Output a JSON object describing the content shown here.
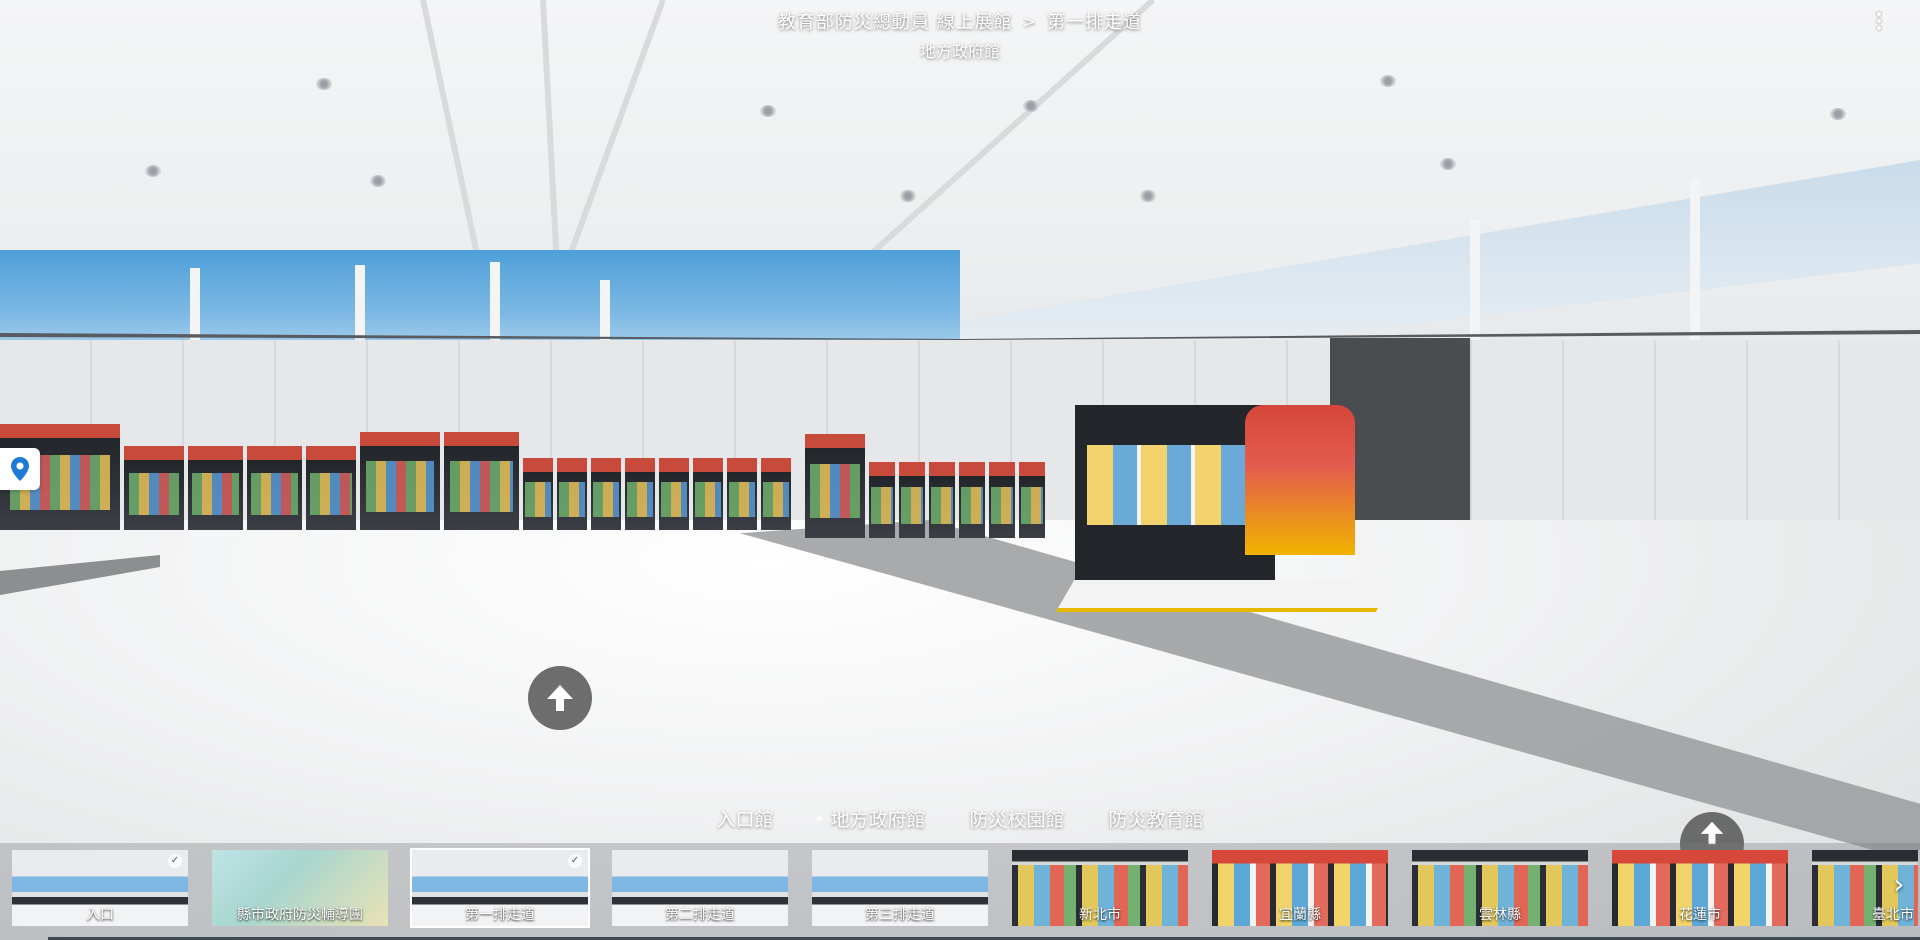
{
  "header": {
    "breadcrumb_root": "教育部防災總動員 線上展館",
    "breadcrumb_sep": ">",
    "breadcrumb_current": "第一排走道",
    "subtitle": "地方政府館"
  },
  "icons": {
    "menu": "more-vertical-icon",
    "map": "map-pin-icon",
    "hotspot": "arrow-up-icon",
    "next": "chevron-right-icon",
    "check": "check-icon"
  },
  "categories": [
    {
      "label": "入口館",
      "has_dot": false
    },
    {
      "label": "地方政府館",
      "has_dot": true
    },
    {
      "label": "防災校園館",
      "has_dot": false
    },
    {
      "label": "防災教育館",
      "has_dot": false
    }
  ],
  "thumbnails": [
    {
      "label": "入口",
      "checked": true,
      "active": false
    },
    {
      "label": "縣市政府防災輔導團",
      "checked": false,
      "active": false
    },
    {
      "label": "第一排走道",
      "checked": true,
      "active": true
    },
    {
      "label": "第二排走道",
      "checked": false,
      "active": false
    },
    {
      "label": "第三排走道",
      "checked": false,
      "active": false
    },
    {
      "label": "新北市",
      "checked": false,
      "active": false
    },
    {
      "label": "宜蘭縣",
      "checked": false,
      "active": false
    },
    {
      "label": "雲林縣",
      "checked": false,
      "active": false
    },
    {
      "label": "花蓮市",
      "checked": false,
      "active": false
    },
    {
      "label": "臺北市",
      "checked": false,
      "active": false
    }
  ],
  "colors": {
    "accent_red": "#c84a3a",
    "hotspot_bg": "#555555",
    "map_pin": "#1e7ad6"
  }
}
